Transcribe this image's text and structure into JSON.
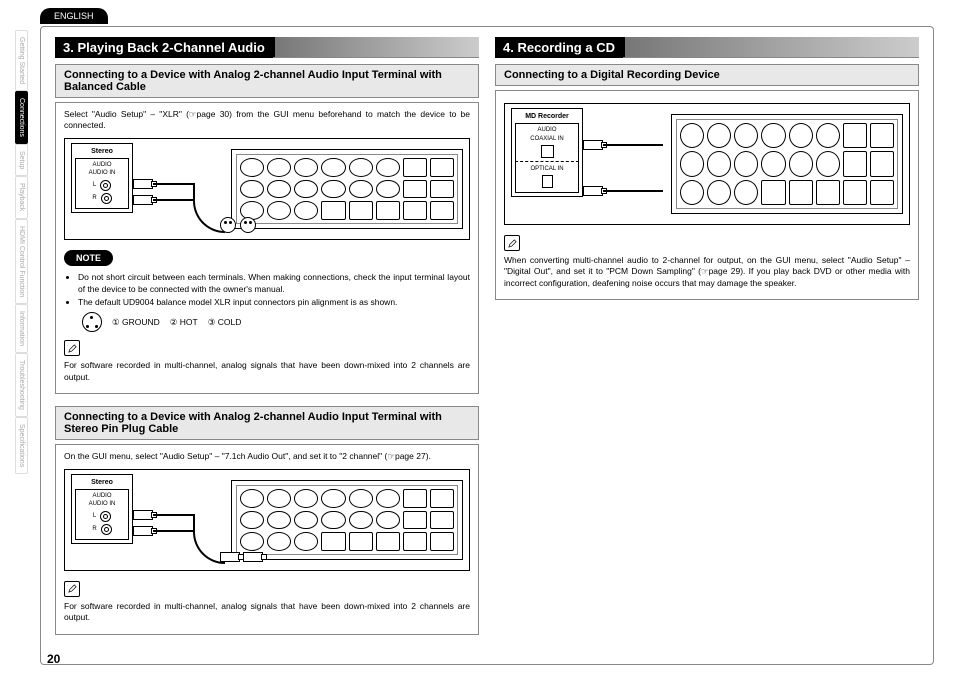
{
  "language_tab": "ENGLISH",
  "side_tabs": [
    "Getting Started",
    "Connections",
    "Setup",
    "Playback",
    "HDMI Control Function",
    "Information",
    "Troubleshooting",
    "Specifications"
  ],
  "side_active_index": 1,
  "page_number": "20",
  "left": {
    "section_title": "3. Playing Back 2-Channel Audio",
    "box1": {
      "subheader": "Connecting to a Device with Analog 2-channel Audio Input Terminal with Balanced Cable",
      "intro": "Select \"Audio Setup\" – \"XLR\" (☞page 30) from the GUI menu beforehand to match the device to be connected.",
      "stereo_label": "Stereo",
      "stereo_sub": "AUDIO",
      "stereo_in": "AUDIO IN",
      "L": "L",
      "R": "R",
      "note_label": "NOTE",
      "notes": [
        "Do not short circuit between each terminals. When making connections, check the input terminal layout of the device to be connected with the owner's manual.",
        "The default UD9004 balance model XLR input connectors pin alignment is as shown."
      ],
      "pins": {
        "p1": "GROUND",
        "p2": "HOT",
        "p3": "COLD",
        "n1": "①",
        "n2": "②",
        "n3": "③"
      },
      "footer": "For software recorded in multi-channel, analog signals that have been down-mixed into 2 channels are output."
    },
    "box2": {
      "subheader": "Connecting to a Device with Analog 2-channel Audio Input Terminal with Stereo Pin Plug Cable",
      "intro": "On the GUI menu, select \"Audio Setup\" – \"7.1ch Audio Out\", and set it to \"2 channel\" (☞page 27).",
      "stereo_label": "Stereo",
      "stereo_sub": "AUDIO",
      "stereo_in": "AUDIO IN",
      "L": "L",
      "R": "R",
      "footer": "For software recorded in multi-channel, analog signals that have been down-mixed into 2 channels are output."
    }
  },
  "right": {
    "section_title": "4. Recording a CD",
    "box1": {
      "subheader": "Connecting to a Digital Recording Device",
      "md_title": "MD Recorder",
      "md_audio": "AUDIO",
      "md_coax": "COAXIAL IN",
      "md_opt": "OPTICAL IN",
      "footer": "When converting multi-channel audio to 2-channel for output, on the GUI menu, select \"Audio Setup\" – \"Digital Out\", and set it to \"PCM Down Sampling\" (☞page 29). If you play back DVD or other media with incorrect configuration, deafening noise occurs that may damage the speaker."
    }
  }
}
